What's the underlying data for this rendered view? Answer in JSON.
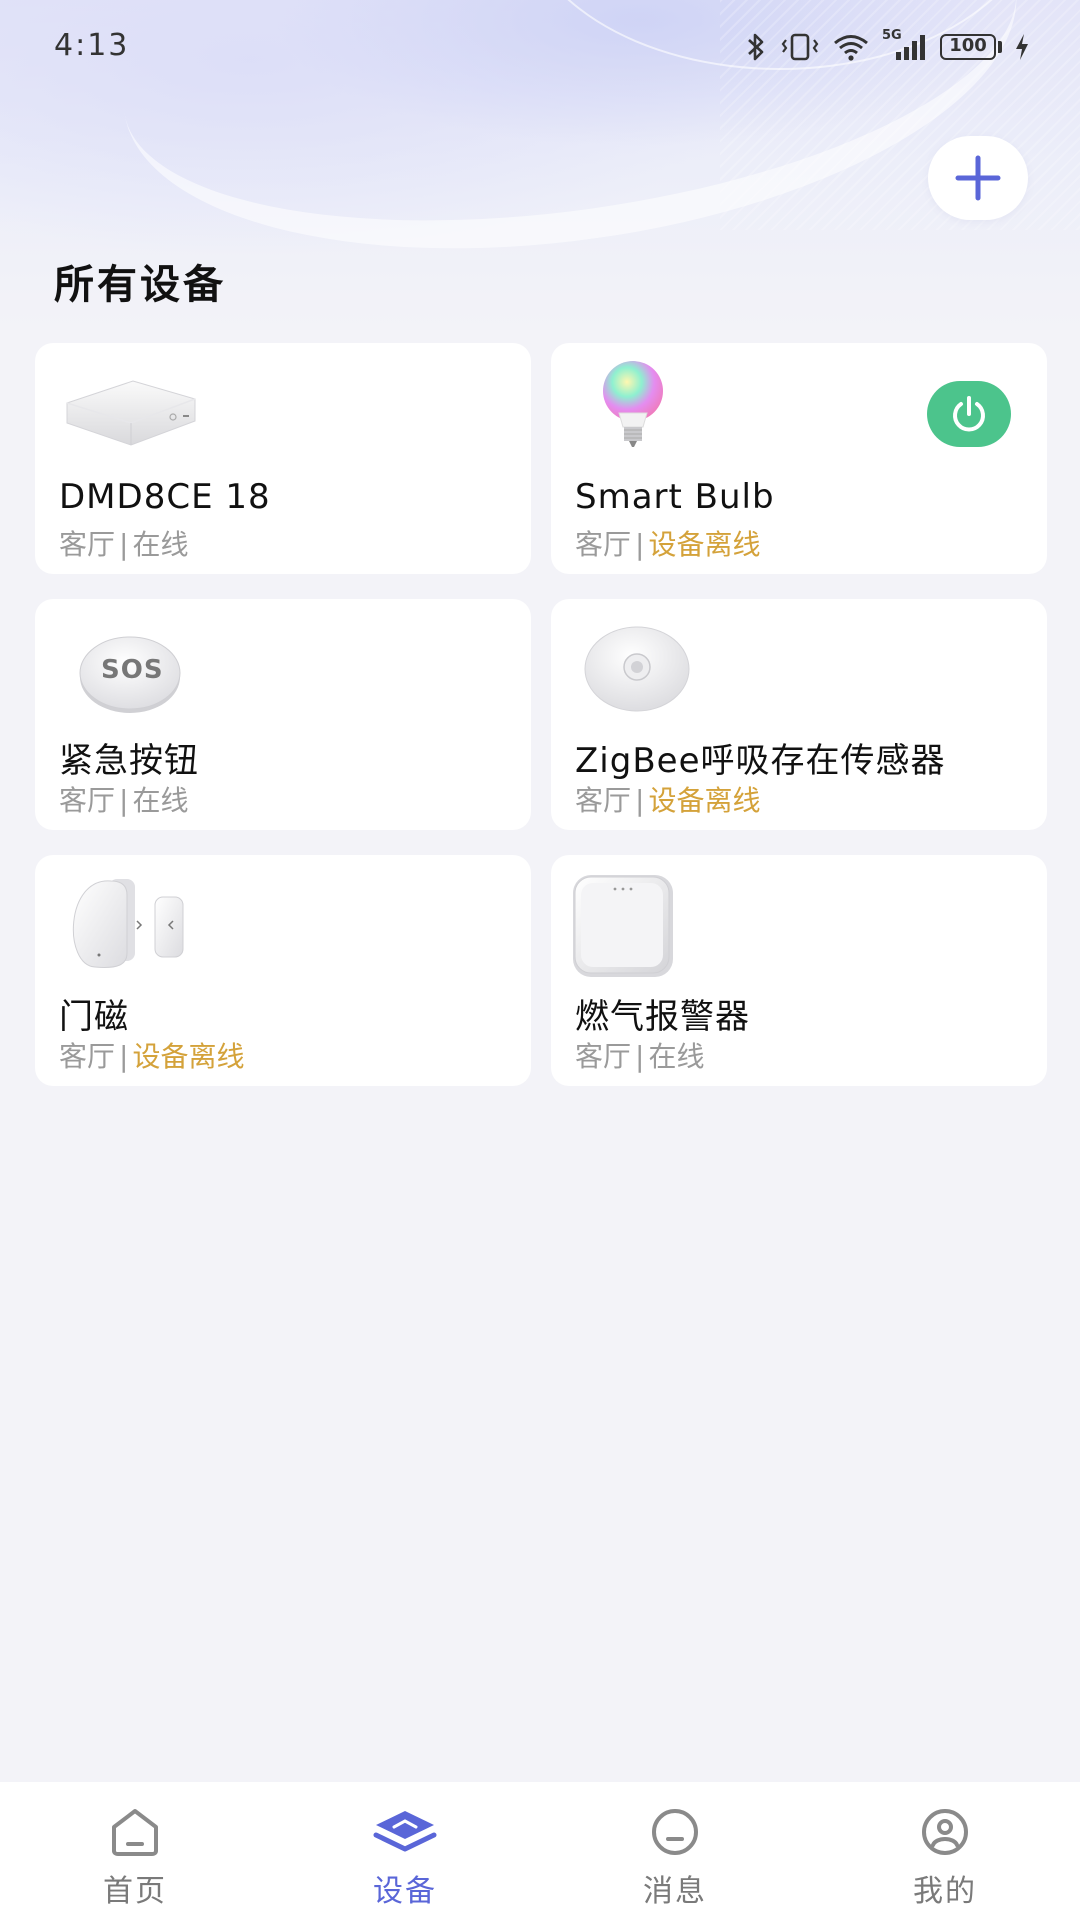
{
  "status_bar": {
    "time": "4:13",
    "network": "5G",
    "battery": "100",
    "icons": [
      "bluetooth-icon",
      "vibrate-icon",
      "wifi-icon",
      "signal-icon",
      "battery-icon",
      "charging-icon"
    ]
  },
  "header": {
    "title": "所有设备",
    "add_icon": "plus-icon"
  },
  "devices": [
    {
      "name": "DMD8CE 18",
      "room": "客厅",
      "separator": "|",
      "status": "在线",
      "online": true,
      "image": "hub-image"
    },
    {
      "name": "Smart Bulb",
      "room": "客厅",
      "separator": "|",
      "status": "设备离线",
      "online": false,
      "image": "bulb-image",
      "power_icon": "power-icon"
    },
    {
      "name": "紧急按钮",
      "room": "客厅",
      "separator": "|",
      "status": "在线",
      "online": true,
      "image": "sos-button-image",
      "image_text": "SOS"
    },
    {
      "name": "ZigBee呼吸存在传感器",
      "room": "客厅",
      "separator": "|",
      "status": "设备离线",
      "online": false,
      "image": "presence-sensor-image"
    },
    {
      "name": "门磁",
      "room": "客厅",
      "separator": "|",
      "status": "设备离线",
      "online": false,
      "image": "door-sensor-image"
    },
    {
      "name": "燃气报警器",
      "room": "客厅",
      "separator": "|",
      "status": "在线",
      "online": true,
      "image": "gas-alarm-image"
    }
  ],
  "colors": {
    "accent": "#5a66d8",
    "offline": "#d4a23a",
    "online_text": "#9a9a9a",
    "power_on": "#4cc48c"
  },
  "bottom_nav": [
    {
      "label": "首页",
      "icon": "home-icon",
      "active": false
    },
    {
      "label": "设备",
      "icon": "devices-icon",
      "active": true
    },
    {
      "label": "消息",
      "icon": "message-icon",
      "active": false
    },
    {
      "label": "我的",
      "icon": "profile-icon",
      "active": false
    }
  ]
}
